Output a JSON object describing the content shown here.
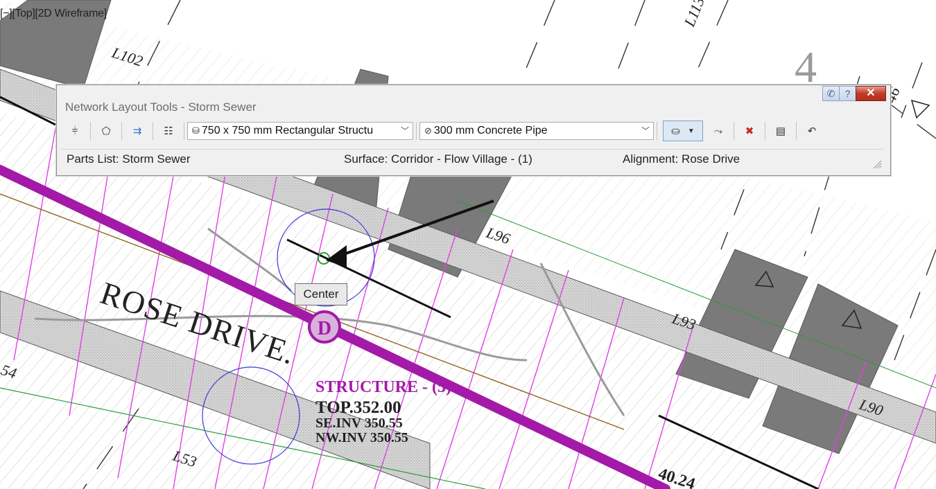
{
  "viewport": {
    "label": "[−][Top][2D Wireframe]",
    "labels": [
      "L102",
      "L113",
      "L96",
      "L93",
      "L90",
      "L53",
      "54",
      "46",
      "4",
      "40.24"
    ],
    "street_name": "ROSE DRIVE.",
    "structure_marker": "D",
    "structure_title": "STRUCTURE - (5)",
    "structure_details": [
      "TOP.352.00",
      "SE.INV 350.55",
      "NW.INV 350.55"
    ],
    "snap_tooltip": "Center",
    "colors": {
      "main_pipe": "#a31aa8",
      "structure_ring": "#a31aa8",
      "snap_circle": "#3b3bd6",
      "hatch": "#cfcfcf",
      "lot_fill": "#7a7a7a",
      "magenta_lines": "#e040e6"
    }
  },
  "toolbar": {
    "title": "Network Layout Tools - Storm Sewer",
    "buttons": [
      {
        "name": "network-properties-icon",
        "glyph": "⫩"
      },
      {
        "name": "select-surface-icon",
        "glyph": "⬠"
      },
      {
        "name": "select-alignment-icon",
        "glyph": "⇉"
      },
      {
        "name": "parts-list-icon",
        "glyph": "☷"
      }
    ],
    "structure_select": "750 x 750 mm Rectangular Structu",
    "pipe_select": "300 mm Concrete Pipe",
    "right_buttons": [
      {
        "name": "draw-pipes-structures-icon",
        "glyph": "⛀"
      },
      {
        "name": "toggle-upslope-icon",
        "glyph": "⤳"
      },
      {
        "name": "delete-part-icon",
        "glyph": "✖"
      },
      {
        "name": "panorama-icon",
        "glyph": "▤"
      },
      {
        "name": "undo-icon",
        "glyph": "↶"
      }
    ],
    "window_buttons": {
      "pin": "✆",
      "help": "?",
      "close": "✕"
    },
    "status": {
      "parts_list": "Parts List: Storm Sewer",
      "surface": "Surface: Corridor - Flow Village - (1)",
      "alignment": "Alignment: Rose Drive"
    }
  }
}
